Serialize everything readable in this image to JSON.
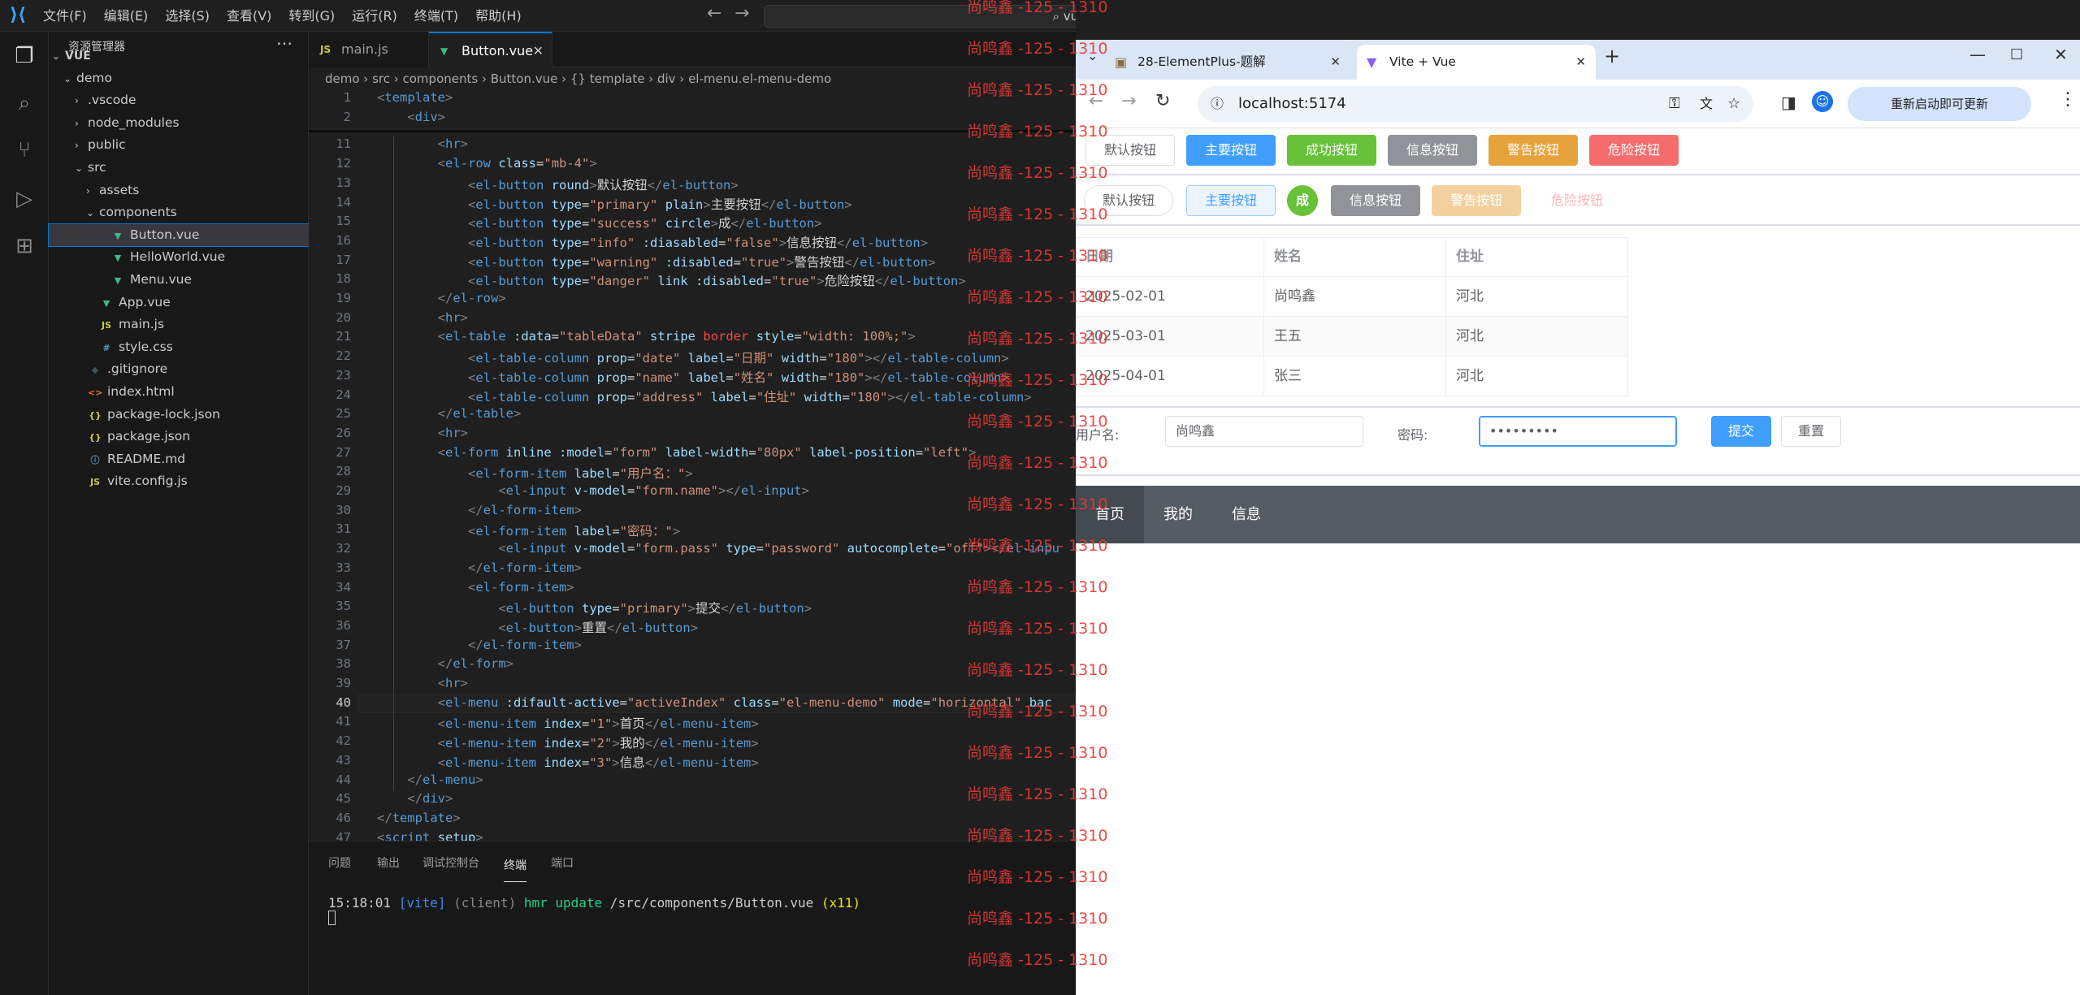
{
  "vscode": {
    "menu": [
      "文件(F)",
      "编辑(E)",
      "选择(S)",
      "查看(V)",
      "转到(G)",
      "运行(R)",
      "终端(T)",
      "帮助(H)"
    ],
    "search_text": "vue",
    "explorer_title": "资源管理器",
    "tree": [
      {
        "label": "VUE",
        "indent": 0,
        "chev": "⌄",
        "type": "root"
      },
      {
        "label": "demo",
        "indent": 1,
        "chev": "⌄",
        "type": "folder"
      },
      {
        "label": ".vscode",
        "indent": 2,
        "chev": "›",
        "type": "folder"
      },
      {
        "label": "node_modules",
        "indent": 2,
        "chev": "›",
        "type": "folder"
      },
      {
        "label": "public",
        "indent": 2,
        "chev": "›",
        "type": "folder"
      },
      {
        "label": "src",
        "indent": 2,
        "chev": "⌄",
        "type": "folder"
      },
      {
        "label": "assets",
        "indent": 3,
        "chev": "›",
        "type": "folder"
      },
      {
        "label": "components",
        "indent": 3,
        "chev": "⌄",
        "type": "folder"
      },
      {
        "label": "Button.vue",
        "indent": 4,
        "chev": "",
        "type": "vue",
        "selected": true
      },
      {
        "label": "HelloWorld.vue",
        "indent": 4,
        "chev": "",
        "type": "vue"
      },
      {
        "label": "Menu.vue",
        "indent": 4,
        "chev": "",
        "type": "vue"
      },
      {
        "label": "App.vue",
        "indent": 3,
        "chev": "",
        "type": "vue"
      },
      {
        "label": "main.js",
        "indent": 3,
        "chev": "",
        "type": "js"
      },
      {
        "label": "style.css",
        "indent": 3,
        "chev": "",
        "type": "css"
      },
      {
        "label": ".gitignore",
        "indent": 2,
        "chev": "",
        "type": "git"
      },
      {
        "label": "index.html",
        "indent": 2,
        "chev": "",
        "type": "html"
      },
      {
        "label": "package-lock.json",
        "indent": 2,
        "chev": "",
        "type": "json"
      },
      {
        "label": "package.json",
        "indent": 2,
        "chev": "",
        "type": "json"
      },
      {
        "label": "README.md",
        "indent": 2,
        "chev": "",
        "type": "md"
      },
      {
        "label": "vite.config.js",
        "indent": 2,
        "chev": "",
        "type": "js"
      }
    ],
    "tabs": [
      {
        "label": "main.js",
        "icon": "JS"
      },
      {
        "label": "Button.vue",
        "icon": "V",
        "active": true
      }
    ],
    "breadcrumb": "demo  ›  src  ›  components  ›  Button.vue  ›  {} template  ›  div  ›  el-menu.el-menu-demo",
    "sticky": [
      {
        "n": "1",
        "html": "<span class='p'>&lt;</span><span class='t'>template</span><span class='p'>&gt;</span>"
      },
      {
        "n": "2",
        "html": "    <span class='p'>&lt;</span><span class='t'>div</span><span class='p'>&gt;</span>"
      }
    ],
    "code": [
      {
        "n": "11",
        "html": "        <span class='p'>&lt;</span><span class='t'>hr</span><span class='p'>&gt;</span>"
      },
      {
        "n": "12",
        "html": "        <span class='p'>&lt;</span><span class='t'>el-row</span> <span class='a'>class</span>=<span class='s'>\"mb-4\"</span><span class='p'>&gt;</span>"
      },
      {
        "n": "13",
        "html": "            <span class='p'>&lt;</span><span class='t'>el-button</span> <span class='a'>round</span><span class='p'>&gt;</span>默认按钮<span class='p'>&lt;/</span><span class='t'>el-button</span><span class='p'>&gt;</span>"
      },
      {
        "n": "14",
        "html": "            <span class='p'>&lt;</span><span class='t'>el-button</span> <span class='a'>type</span>=<span class='s'>\"primary\"</span> <span class='a'>plain</span><span class='p'>&gt;</span>主要按钮<span class='p'>&lt;/</span><span class='t'>el-button</span><span class='p'>&gt;</span>"
      },
      {
        "n": "15",
        "html": "            <span class='p'>&lt;</span><span class='t'>el-button</span> <span class='a'>type</span>=<span class='s'>\"success\"</span> <span class='a'>circle</span><span class='p'>&gt;</span>成<span class='p'>&lt;/</span><span class='t'>el-button</span><span class='p'>&gt;</span>"
      },
      {
        "n": "16",
        "html": "            <span class='p'>&lt;</span><span class='t'>el-button</span> <span class='a'>type</span>=<span class='s'>\"info\"</span> <span class='a'>:diasabled</span>=<span class='s'>\"false\"</span><span class='p'>&gt;</span>信息按钮<span class='p'>&lt;/</span><span class='t'>el-button</span><span class='p'>&gt;</span>"
      },
      {
        "n": "17",
        "html": "            <span class='p'>&lt;</span><span class='t'>el-button</span> <span class='a'>type</span>=<span class='s'>\"warning\"</span> <span class='a'>:disabled</span>=<span class='s'>\"true\"</span><span class='p'>&gt;</span>警告按钮<span class='p'>&lt;/</span><span class='t'>el-button</span><span class='p'>&gt;</span>"
      },
      {
        "n": "18",
        "html": "            <span class='p'>&lt;</span><span class='t'>el-button</span> <span class='a'>type</span>=<span class='s'>\"danger\"</span> <span class='a'>link</span> <span class='a'>:disabled</span>=<span class='s'>\"true\"</span><span class='p'>&gt;</span>危险按钮<span class='p'>&lt;/</span><span class='t'>el-button</span><span class='p'>&gt;</span>"
      },
      {
        "n": "19",
        "html": "        <span class='p'>&lt;/</span><span class='t'>el-row</span><span class='p'>&gt;</span>"
      },
      {
        "n": "20",
        "html": "        <span class='p'>&lt;</span><span class='t'>hr</span><span class='p'>&gt;</span>"
      },
      {
        "n": "21",
        "html": "        <span class='p'>&lt;</span><span class='t'>el-table</span> <span class='a'>:data</span>=<span class='s'>\"tableData\"</span> <span class='a'>stripe</span> <span class='r'>border</span> <span class='a'>style</span>=<span class='s'>\"width: 100%;\"</span><span class='p'>&gt;</span>"
      },
      {
        "n": "22",
        "html": "            <span class='p'>&lt;</span><span class='t'>el-table-column</span> <span class='a'>prop</span>=<span class='s'>\"date\"</span> <span class='a'>label</span>=<span class='s'>\"日期\"</span> <span class='a'>width</span>=<span class='s'>\"180\"</span><span class='p'>&gt;&lt;/</span><span class='t'>el-table-column</span><span class='p'>&gt;</span>"
      },
      {
        "n": "23",
        "html": "            <span class='p'>&lt;</span><span class='t'>el-table-column</span> <span class='a'>prop</span>=<span class='s'>\"name\"</span> <span class='a'>label</span>=<span class='s'>\"姓名\"</span> <span class='a'>width</span>=<span class='s'>\"180\"</span><span class='p'>&gt;&lt;/</span><span class='t'>el-table-column</span><span class='p'>&gt;</span>"
      },
      {
        "n": "24",
        "html": "            <span class='p'>&lt;</span><span class='t'>el-table-column</span> <span class='a'>prop</span>=<span class='s'>\"address\"</span> <span class='a'>label</span>=<span class='s'>\"住址\"</span> <span class='a'>width</span>=<span class='s'>\"180\"</span><span class='p'>&gt;&lt;/</span><span class='t'>el-table-column</span><span class='p'>&gt;</span>"
      },
      {
        "n": "25",
        "html": "        <span class='p'>&lt;/</span><span class='t'>el-table</span><span class='p'>&gt;</span>"
      },
      {
        "n": "26",
        "html": "        <span class='p'>&lt;</span><span class='t'>hr</span><span class='p'>&gt;</span>"
      },
      {
        "n": "27",
        "html": "        <span class='p'>&lt;</span><span class='t'>el-form</span> <span class='a'>inline</span> <span class='a'>:model</span>=<span class='s'>\"form\"</span> <span class='a'>label-width</span>=<span class='s'>\"80px\"</span> <span class='a'>label-position</span>=<span class='s'>\"left\"</span><span class='p'>&gt;</span>"
      },
      {
        "n": "28",
        "html": "            <span class='p'>&lt;</span><span class='t'>el-form-item</span> <span class='a'>label</span>=<span class='s'>\"用户名：\"</span><span class='p'>&gt;</span>"
      },
      {
        "n": "29",
        "html": "                <span class='p'>&lt;</span><span class='t'>el-input</span> <span class='a'>v-model</span>=<span class='s'>\"form.name\"</span><span class='p'>&gt;&lt;/</span><span class='t'>el-input</span><span class='p'>&gt;</span>"
      },
      {
        "n": "30",
        "html": "            <span class='p'>&lt;/</span><span class='t'>el-form-item</span><span class='p'>&gt;</span>"
      },
      {
        "n": "31",
        "html": "            <span class='p'>&lt;</span><span class='t'>el-form-item</span> <span class='a'>label</span>=<span class='s'>\"密码：\"</span><span class='p'>&gt;</span>"
      },
      {
        "n": "32",
        "html": "                <span class='p'>&lt;</span><span class='t'>el-input</span> <span class='a'>v-model</span>=<span class='s'>\"form.pass\"</span> <span class='a'>type</span>=<span class='s'>\"password\"</span> <span class='a'>autocomplete</span>=<span class='s'>\"off\"</span><span class='p'>&gt;&lt;/</span><span class='t'>el-inpu</span>"
      },
      {
        "n": "33",
        "html": "            <span class='p'>&lt;/</span><span class='t'>el-form-item</span><span class='p'>&gt;</span>"
      },
      {
        "n": "34",
        "html": "            <span class='p'>&lt;</span><span class='t'>el-form-item</span><span class='p'>&gt;</span>"
      },
      {
        "n": "35",
        "html": "                <span class='p'>&lt;</span><span class='t'>el-button</span> <span class='a'>type</span>=<span class='s'>\"primary\"</span><span class='p'>&gt;</span>提交<span class='p'>&lt;/</span><span class='t'>el-button</span><span class='p'>&gt;</span>"
      },
      {
        "n": "36",
        "html": "                <span class='p'>&lt;</span><span class='t'>el-button</span><span class='p'>&gt;</span>重置<span class='p'>&lt;/</span><span class='t'>el-button</span><span class='p'>&gt;</span>"
      },
      {
        "n": "37",
        "html": "            <span class='p'>&lt;/</span><span class='t'>el-form-item</span><span class='p'>&gt;</span>"
      },
      {
        "n": "38",
        "html": "        <span class='p'>&lt;/</span><span class='t'>el-form</span><span class='p'>&gt;</span>"
      },
      {
        "n": "39",
        "html": "        <span class='p'>&lt;</span><span class='t'>hr</span><span class='p'>&gt;</span>"
      },
      {
        "n": "40",
        "html": "        <span class='p'>&lt;</span><span class='t'>el-menu</span> <span class='a'>:difault-active</span>=<span class='s'>\"activeIndex\"</span> <span class='a'>class</span>=<span class='s'>\"el-menu-demo\"</span> <span class='a'>mode</span>=<span class='s'>\"horizontal\"</span> <span class='a'>bac</span>",
        "cur": true
      },
      {
        "n": "41",
        "html": "        <span class='p'>&lt;</span><span class='t'>el-menu-item</span> <span class='a'>index</span>=<span class='s'>\"1\"</span><span class='p'>&gt;</span>首页<span class='p'>&lt;/</span><span class='t'>el-menu-item</span><span class='p'>&gt;</span>"
      },
      {
        "n": "42",
        "html": "        <span class='p'>&lt;</span><span class='t'>el-menu-item</span> <span class='a'>index</span>=<span class='s'>\"2\"</span><span class='p'>&gt;</span>我的<span class='p'>&lt;/</span><span class='t'>el-menu-item</span><span class='p'>&gt;</span>"
      },
      {
        "n": "43",
        "html": "        <span class='p'>&lt;</span><span class='t'>el-menu-item</span> <span class='a'>index</span>=<span class='s'>\"3\"</span><span class='p'>&gt;</span>信息<span class='p'>&lt;/</span><span class='t'>el-menu-item</span><span class='p'>&gt;</span>"
      },
      {
        "n": "44",
        "html": "    <span class='p'>&lt;/</span><span class='t'>el-menu</span><span class='p'>&gt;</span>"
      },
      {
        "n": "45",
        "html": "    <span class='p'>&lt;/</span><span class='t'>div</span><span class='p'>&gt;</span>"
      },
      {
        "n": "46",
        "html": "<span class='p'>&lt;/</span><span class='t'>template</span><span class='p'>&gt;</span>"
      },
      {
        "n": "47",
        "html": "<span class='p'>&lt;</span><span class='t'>script</span> <span class='a'>setup</span><span class='p'>&gt;</span>"
      }
    ],
    "panel_tabs": [
      "问题",
      "输出",
      "调试控制台",
      "终端",
      "端口"
    ],
    "panel_active": "终端",
    "terminal_line": "15:18:01 [vite] (client) hmr update /src/components/Button.vue (x11)"
  },
  "watermark": "尚鸣鑫 -125 - 1310",
  "browser": {
    "tabs": [
      {
        "label": "28-ElementPlus-题解"
      },
      {
        "label": "Vite + Vue",
        "active": true
      }
    ],
    "url": "localhost:5174",
    "update_label": "重新启动即可更新",
    "row1_buttons": [
      {
        "label": "默认按钮",
        "bg": "#ffffff",
        "fg": "#606266",
        "bd": "#dcdfe6"
      },
      {
        "label": "主要按钮",
        "bg": "#409eff",
        "fg": "#ffffff",
        "bd": "#409eff"
      },
      {
        "label": "成功按钮",
        "bg": "#67c23a",
        "fg": "#ffffff",
        "bd": "#67c23a"
      },
      {
        "label": "信息按钮",
        "bg": "#909399",
        "fg": "#ffffff",
        "bd": "#909399"
      },
      {
        "label": "警告按钮",
        "bg": "#e6a23c",
        "fg": "#ffffff",
        "bd": "#e6a23c"
      },
      {
        "label": "危险按钮",
        "bg": "#f56c6c",
        "fg": "#ffffff",
        "bd": "#f56c6c"
      }
    ],
    "row2_buttons": [
      {
        "label": "默认按钮",
        "bg": "#ffffff",
        "fg": "#606266",
        "bd": "#dcdfe6",
        "round": true
      },
      {
        "label": "主要按钮",
        "bg": "#ecf5ff",
        "fg": "#409eff",
        "bd": "#a0cfff"
      },
      {
        "label": "成",
        "bg": "#67c23a",
        "fg": "#ffffff",
        "bd": "#67c23a",
        "circle": true
      },
      {
        "label": "信息按钮",
        "bg": "#909399",
        "fg": "#ffffff",
        "bd": "#909399"
      },
      {
        "label": "警告按钮",
        "bg": "#f3d19e",
        "fg": "#ffffff",
        "bd": "#f3d19e"
      },
      {
        "label": "危险按钮",
        "bg": "transparent",
        "fg": "#fab6b6",
        "bd": "transparent"
      }
    ],
    "table": {
      "headers": [
        "日期",
        "姓名",
        "住址"
      ],
      "rows": [
        [
          "2025-02-01",
          "尚鸣鑫",
          "河北"
        ],
        [
          "2025-03-01",
          "王五",
          "河北"
        ],
        [
          "2025-04-01",
          "张三",
          "河北"
        ]
      ]
    },
    "form": {
      "name_label": "用户名:",
      "name_value": "尚鸣鑫",
      "pass_label": "密码:",
      "pass_value": "•••••••••",
      "submit": "提交",
      "reset": "重置"
    },
    "menu": [
      "首页",
      "我的",
      "信息"
    ],
    "colors": {
      "menu_bg": "#545c64",
      "primary": "#409eff"
    }
  }
}
